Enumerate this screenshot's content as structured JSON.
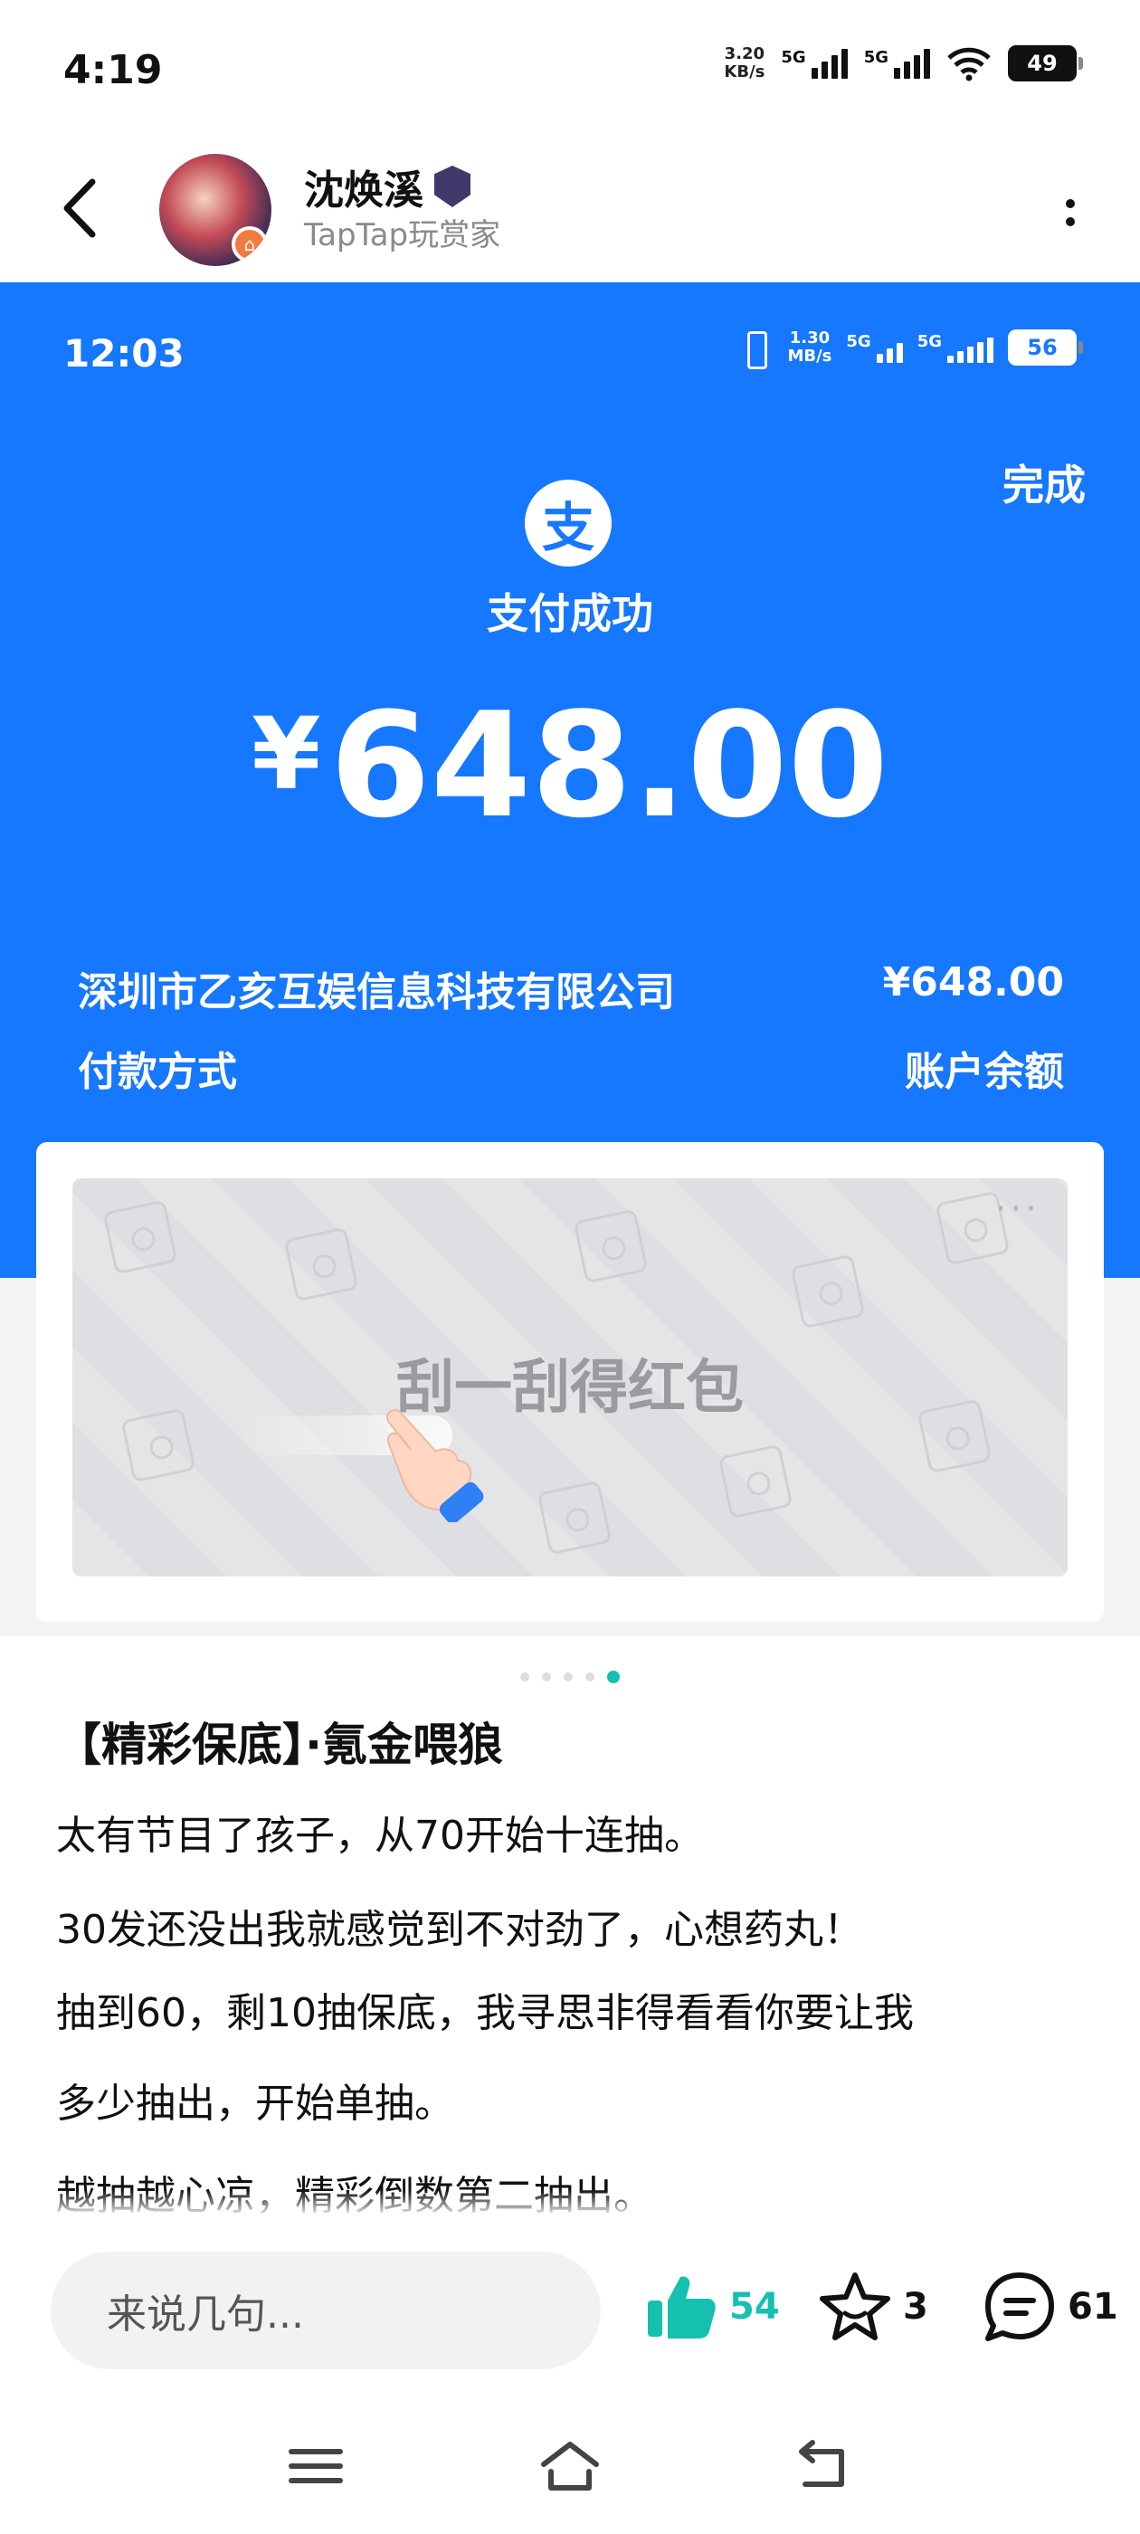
{
  "statusbar": {
    "time": "4:19",
    "net_speed_value": "3.20",
    "net_speed_unit": "KB/s",
    "sim1": "5G",
    "sim2": "5G",
    "battery": "49"
  },
  "post_header": {
    "user_name": "沈焕溪",
    "user_subtitle": "TapTap玩赏家"
  },
  "screenshot": {
    "statusbar": {
      "time": "12:03",
      "net_speed_value": "1.30",
      "net_speed_unit": "MB/s",
      "sim1": "5G",
      "sim2": "5G",
      "battery": "56"
    },
    "done_label": "完成",
    "logo_char": "支",
    "status_text": "支付成功",
    "amount_currency": "¥",
    "amount_value": "648.00",
    "merchant_name": "深圳市乙亥互娱信息科技有限公司",
    "merchant_amount": "¥648.00",
    "payment_method_label": "付款方式",
    "payment_method_value": "账户余额",
    "scratch_dots": "···",
    "scratch_text": "刮一刮得红包"
  },
  "carousel": {
    "count": 5,
    "active_index": 4
  },
  "post": {
    "title": "【精彩保底】·氪金喂狼",
    "paragraphs": [
      "太有节目了孩子，从70开始十连抽。",
      "30发还没出我就感觉到不对劲了，心想药丸！",
      "抽到60，剩10抽保底，我寻思非得看看你要让我",
      "多少抽出，开始单抽。",
      "越抽越心凉，精彩倒数第二抽出。"
    ]
  },
  "action_bar": {
    "comment_placeholder": "来说几句...",
    "like_count": "54",
    "favorite_count": "3",
    "comment_count": "61",
    "accent_color": "#16c0b0"
  },
  "colors": {
    "alipay_blue": "#1677ff",
    "teal": "#16c0b0"
  }
}
